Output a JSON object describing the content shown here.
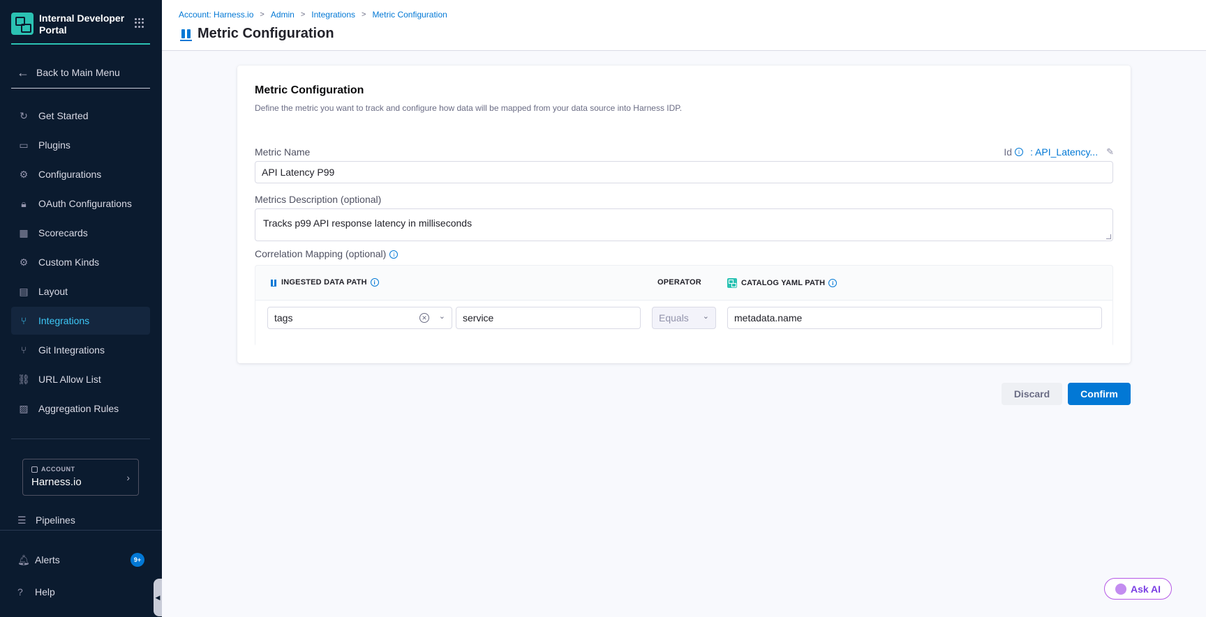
{
  "sidebar": {
    "brand": "Internal Developer Portal",
    "back_label": "Back to Main Menu",
    "items": [
      {
        "label": "Get Started",
        "icon": "rocket-icon"
      },
      {
        "label": "Plugins",
        "icon": "plugin-icon"
      },
      {
        "label": "Configurations",
        "icon": "gears-icon"
      },
      {
        "label": "OAuth Configurations",
        "icon": "lock-icon"
      },
      {
        "label": "Scorecards",
        "icon": "scorecard-icon"
      },
      {
        "label": "Custom Kinds",
        "icon": "gear-icon"
      },
      {
        "label": "Layout",
        "icon": "layout-icon"
      },
      {
        "label": "Integrations",
        "icon": "integration-icon",
        "active": true
      },
      {
        "label": "Git Integrations",
        "icon": "git-icon"
      },
      {
        "label": "URL Allow List",
        "icon": "link-icon"
      },
      {
        "label": "Aggregation Rules",
        "icon": "chart-icon"
      }
    ],
    "account": {
      "label": "ACCOUNT",
      "name": "Harness.io"
    },
    "pipelines_label": "Pipelines",
    "alerts_label": "Alerts",
    "alerts_badge": "9+",
    "help_label": "Help"
  },
  "header": {
    "breadcrumbs": [
      "Account: Harness.io",
      "Admin",
      "Integrations",
      "Metric Configuration"
    ],
    "title": "Metric Configuration"
  },
  "card": {
    "title": "Metric Configuration",
    "description": "Define the metric you want to track and configure how data will be mapped from your data source into Harness IDP.",
    "metric_name_label": "Metric Name",
    "id_label": "Id",
    "id_value": ": API_Latency...",
    "metric_name_value": "API Latency P99",
    "description_label": "Metrics Description (optional)",
    "description_value": "Tracks p99 API response latency in milliseconds",
    "mapping_label": "Correlation Mapping (optional)",
    "mapping": {
      "col_ingested": "INGESTED DATA PATH",
      "col_operator": "OPERATOR",
      "col_catalog": "CATALOG YAML PATH",
      "ingested_select": "tags",
      "ingested_key": "service",
      "operator": "Equals",
      "catalog_path": "metadata.name"
    }
  },
  "actions": {
    "discard": "Discard",
    "confirm": "Confirm"
  },
  "ask_ai": "Ask AI",
  "colors": {
    "sidebar_bg": "#0b1b2f",
    "accent": "#0278d5",
    "brand": "#2bc2b3",
    "active_text": "#3dc7f6"
  }
}
